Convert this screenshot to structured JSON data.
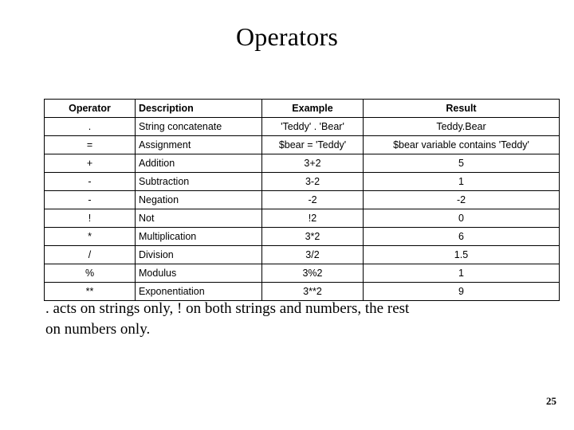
{
  "slide": {
    "title": "Operators",
    "page_number": "25",
    "note_lines": [
      ". acts on strings only, ! on both strings and numbers, the rest",
      "on numbers only."
    ],
    "table": {
      "headers": [
        "Operator",
        "Description",
        "Example",
        "Result"
      ],
      "rows": [
        [
          ".",
          "String concatenate",
          "'Teddy' . 'Bear'",
          "Teddy.Bear"
        ],
        [
          "=",
          "Assignment",
          "$bear = 'Teddy'",
          "$bear variable contains 'Teddy'"
        ],
        [
          "+",
          "Addition",
          "3+2",
          "5"
        ],
        [
          "-",
          "Subtraction",
          "3-2",
          "1"
        ],
        [
          "-",
          "Negation",
          "-2",
          "-2"
        ],
        [
          "!",
          "Not",
          "!2",
          "0"
        ],
        [
          "*",
          "Multiplication",
          "3*2",
          "6"
        ],
        [
          "/",
          "Division",
          "3/2",
          "1.5"
        ],
        [
          "%",
          "Modulus",
          "3%2",
          "1"
        ],
        [
          "**",
          "Exponentiation",
          "3**2",
          "9"
        ]
      ]
    }
  }
}
